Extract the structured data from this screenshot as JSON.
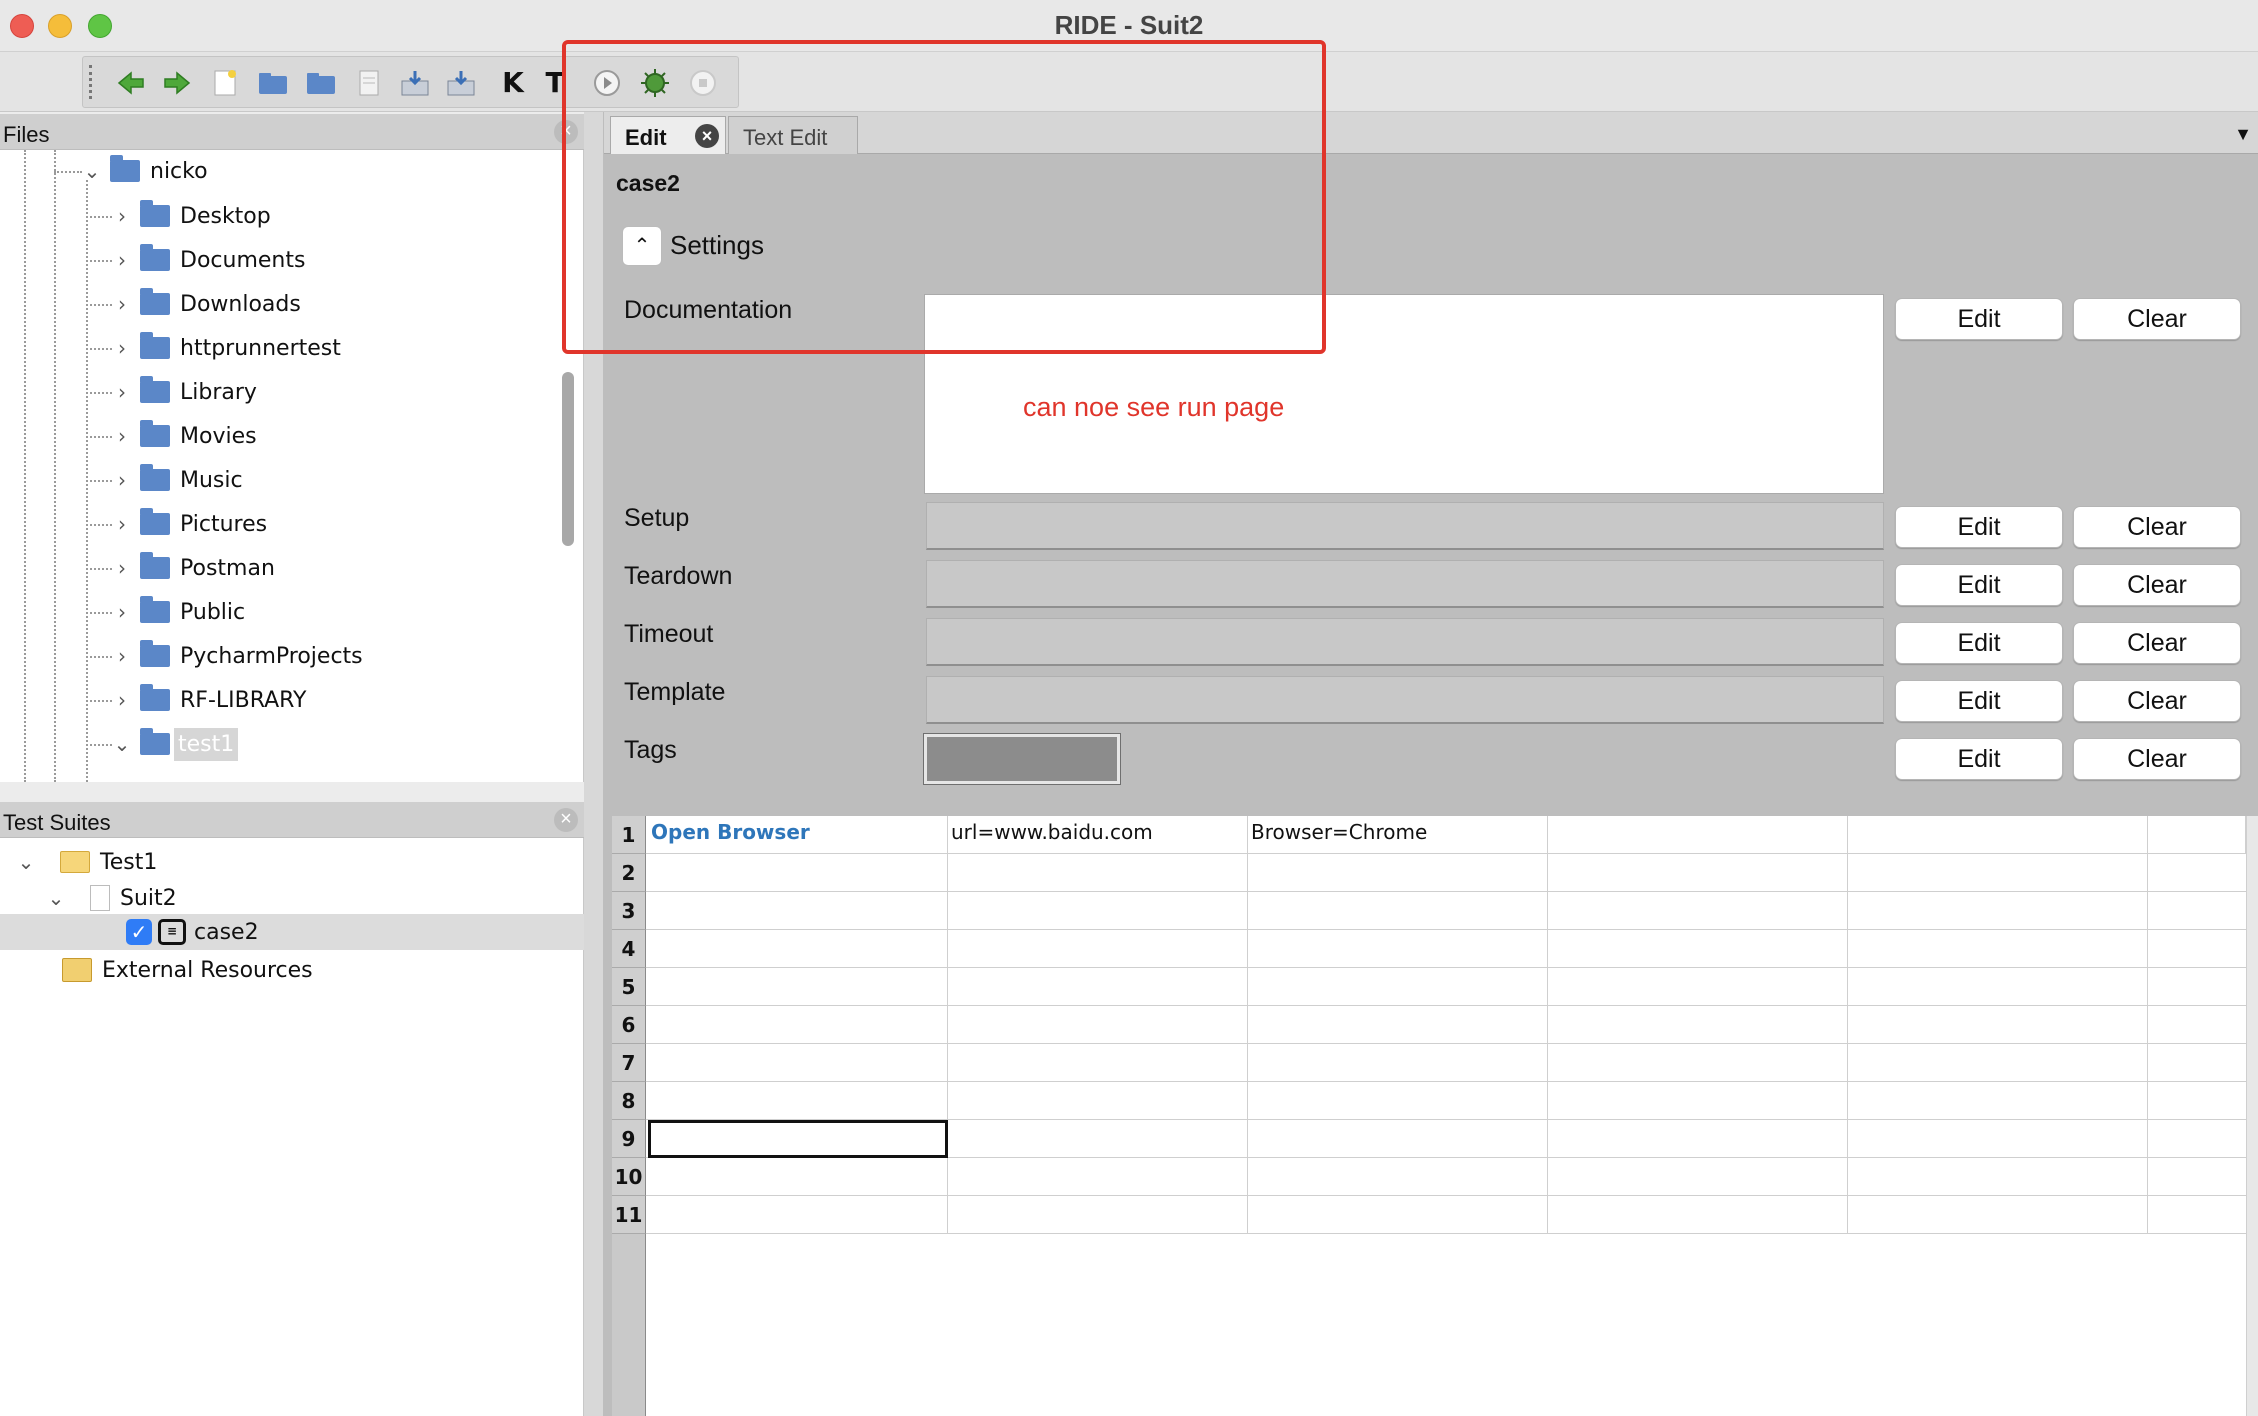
{
  "window": {
    "title": "RIDE - Suit2"
  },
  "toolbar": {
    "back_icon": "arrow-left-icon",
    "forward_icon": "arrow-right-icon",
    "k_label": "K",
    "t_label": "T"
  },
  "files_pane": {
    "title": "Files",
    "root": "nicko",
    "items": [
      "Desktop",
      "Documents",
      "Downloads",
      "httprunnertest",
      "Library",
      "Movies",
      "Music",
      "Pictures",
      "Postman",
      "Public",
      "PycharmProjects",
      "RF-LIBRARY",
      "test1"
    ]
  },
  "suites_pane": {
    "title": "Test Suites",
    "project": "Test1",
    "suite": "Suit2",
    "testcase": "case2",
    "external": "External Resources"
  },
  "editor": {
    "tabs": [
      "Edit",
      "Text Edit"
    ],
    "case_title": "case2",
    "settings_label": "Settings",
    "fields": [
      "Documentation",
      "Setup",
      "Teardown",
      "Timeout",
      "Template",
      "Tags"
    ],
    "edit_label": "Edit",
    "clear_label": "Clear",
    "annotation": "can noe see run page",
    "annotation_color": "#e0352b"
  },
  "grid": {
    "rows": [
      "1",
      "2",
      "3",
      "4",
      "5",
      "6",
      "7",
      "8",
      "9",
      "10",
      "11"
    ],
    "row1": [
      "Open Browser",
      "url=www.baidu.com",
      "Browser=Chrome"
    ],
    "keyword_color": "#2e76ba"
  }
}
